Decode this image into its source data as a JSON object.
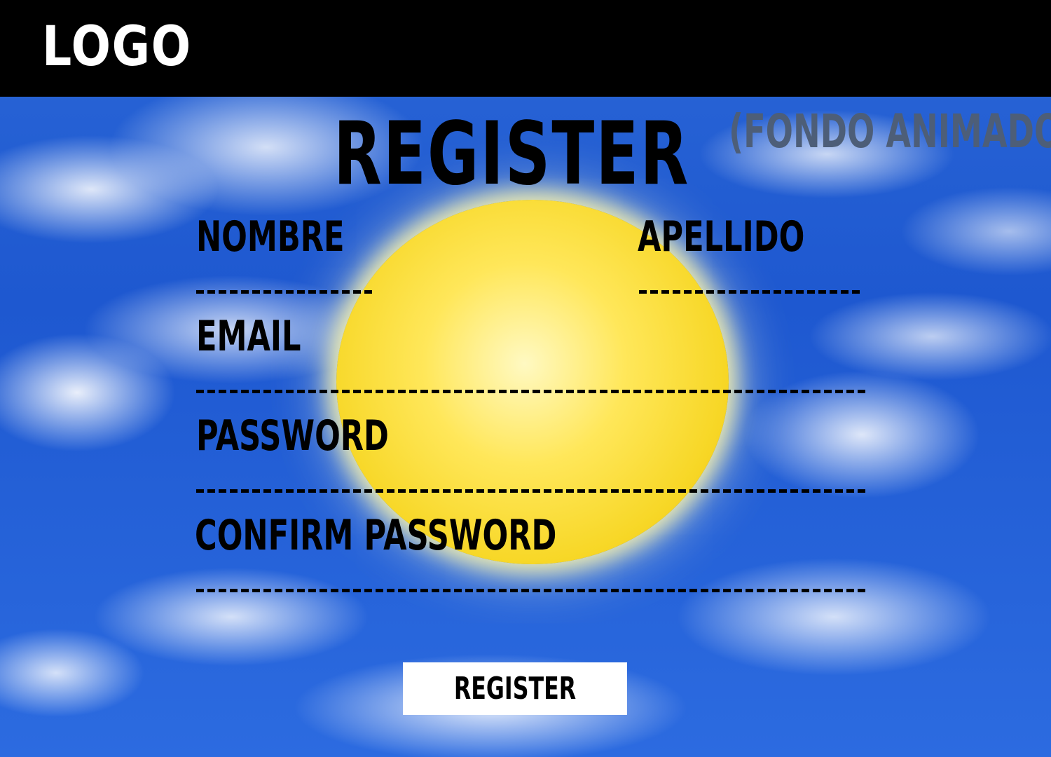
{
  "header": {
    "logo_text": "LOGO"
  },
  "page": {
    "title": "REGISTER",
    "background_note": "(FONDO ANIMADO)"
  },
  "form": {
    "nombre_label": "NOMBRE",
    "apellido_label": "APELLIDO",
    "email_label": "EMAIL",
    "password_label": "PASSWORD",
    "confirm_password_label": "CONFIRM PASSWORD",
    "nombre_value": "",
    "apellido_value": "",
    "email_value": "",
    "password_value": "",
    "confirm_password_value": "",
    "submit_label": "REGISTER"
  },
  "colors": {
    "header_bg": "#000000",
    "logo_text": "#ffffff",
    "label_text": "#000000",
    "note_text": "#4d5e78",
    "button_bg": "#ffffff"
  },
  "background": {
    "image": "sky-with-sun-and-clouds"
  }
}
